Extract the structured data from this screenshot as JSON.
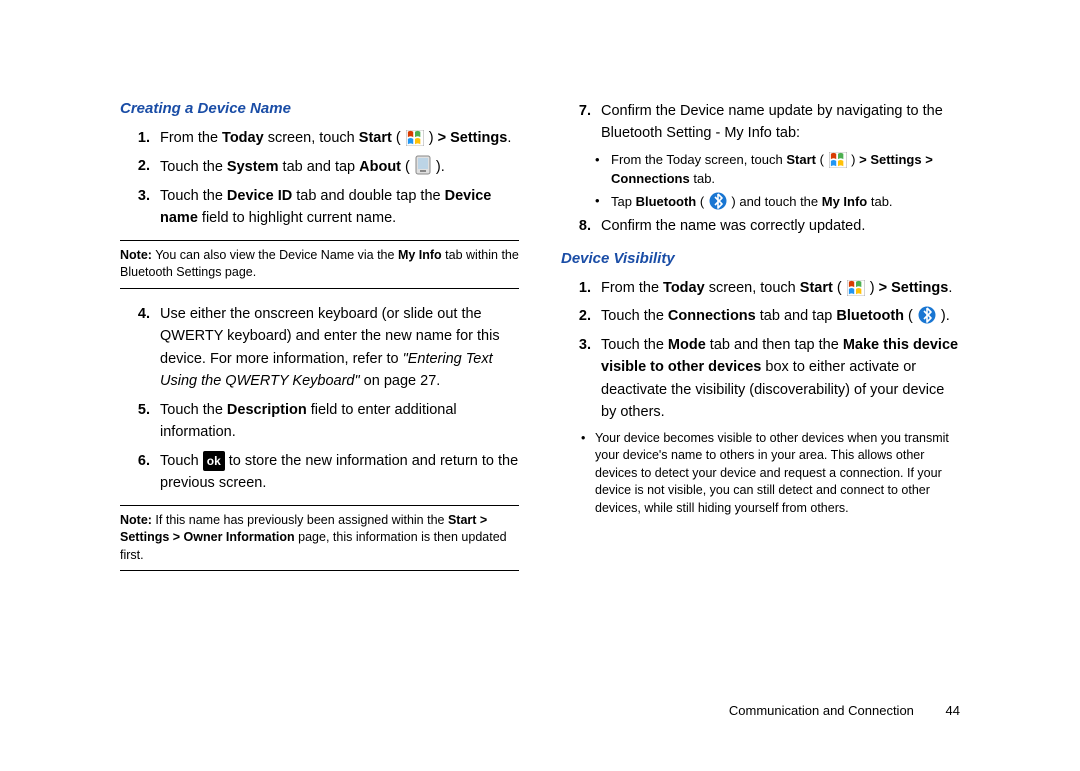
{
  "left": {
    "heading": "Creating a Device Name",
    "steps": [
      {
        "n": "1.",
        "pre": "From the ",
        "b1": "Today",
        "mid1": " screen, touch ",
        "b2": "Start",
        "mid2": " ( ",
        "post": " ) ",
        "b3": "> Settings",
        "end": "."
      },
      {
        "n": "2.",
        "pre": "Touch the ",
        "b1": "System",
        "mid1": " tab and tap ",
        "b2": "About",
        "mid2": " ( ",
        "post": " )."
      },
      {
        "n": "3.",
        "pre": "Touch the ",
        "b1": "Device ID",
        "mid1": " tab and double tap the ",
        "b2": "Device name",
        "mid2": " field to highlight current name."
      }
    ],
    "note1_lead": "Note:",
    "note1_text_a": " You can also view the Device Name via the ",
    "note1_b": "My Info",
    "note1_text_b": " tab within the Bluetooth Settings page.",
    "steps2": [
      {
        "n": "4.",
        "text_a": "Use either the onscreen keyboard (or slide out the QWERTY keyboard) and enter the new name for this device. For more information, refer to ",
        "ital": "\"Entering Text Using the QWERTY Keyboard\"",
        "text_b": "  on page 27."
      },
      {
        "n": "5.",
        "pre": "Touch the ",
        "b1": "Description",
        "text": " field to enter additional information."
      },
      {
        "n": "6.",
        "pre": "Touch  ",
        "ok": "ok",
        "text": "  to store the new information and return to the previous screen."
      }
    ],
    "note2_lead": "Note:",
    "note2_a": " If this name has previously been assigned within the ",
    "note2_b1": "Start > Settings > Owner Information",
    "note2_b": " page, this information is then updated first."
  },
  "right": {
    "step7": {
      "n": "7.",
      "text": "Confirm the Device name update by navigating to the Bluetooth Setting - My Info tab:"
    },
    "b1_pre": "From the Today screen, touch ",
    "b1_b1": "Start",
    "b1_mid": " ( ",
    "b1_post": " ) ",
    "b1_b2": "> Settings > Connections",
    "b1_end": " tab.",
    "b2_pre": "Tap ",
    "b2_b1": "Bluetooth",
    "b2_mid": " ( ",
    "b2_post": " ) and touch the ",
    "b2_b2": "My Info",
    "b2_end": " tab.",
    "step8": {
      "n": "8.",
      "text": "Confirm the name was correctly updated."
    },
    "heading2": "Device Visibility",
    "dv1": {
      "n": "1.",
      "pre": "From the ",
      "b1": "Today",
      "mid1": " screen, touch ",
      "b2": "Start",
      "mid2": " ( ",
      "post": " ) ",
      "b3": "> Settings",
      "end": "."
    },
    "dv2": {
      "n": "2.",
      "pre": "Touch the ",
      "b1": "Connections",
      "mid1": " tab and tap ",
      "b2": "Bluetooth",
      "mid2": " ( ",
      "post": " )."
    },
    "dv3": {
      "n": "3.",
      "pre": "Touch the ",
      "b1": "Mode",
      "mid1": " tab and then tap the ",
      "b2": "Make this device visible to other devices",
      "text": " box to either activate or deactivate the visibility (discoverability) of your device by others."
    },
    "dv_note": "Your device becomes visible to other devices when you transmit your device's name to others in your area. This allows other devices to detect your device and request a connection. If your device is not visible, you can still detect and connect to other devices, while still hiding yourself from others."
  },
  "footer": {
    "section": "Communication and Connection",
    "page": "44"
  }
}
